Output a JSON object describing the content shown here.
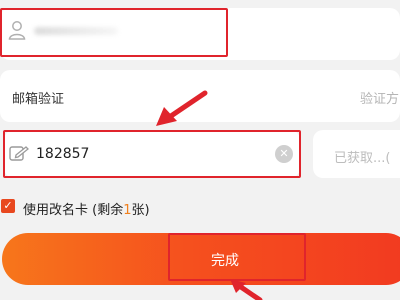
{
  "form": {
    "email_label": "邮箱验证",
    "email_placeholder": "验证方",
    "code_value": "182857",
    "resend_label": "已获取...(",
    "rename_card_prefix": "使用改名卡 (剩余",
    "rename_card_count": "1",
    "rename_card_suffix": "张)",
    "done_label": "完成"
  },
  "icons": {
    "username": "user-icon",
    "code": "edit-icon",
    "clear": "clear-icon",
    "checkbox": "check-icon"
  },
  "colors": {
    "accent": "#e8481f",
    "highlight": "#e0242c"
  }
}
